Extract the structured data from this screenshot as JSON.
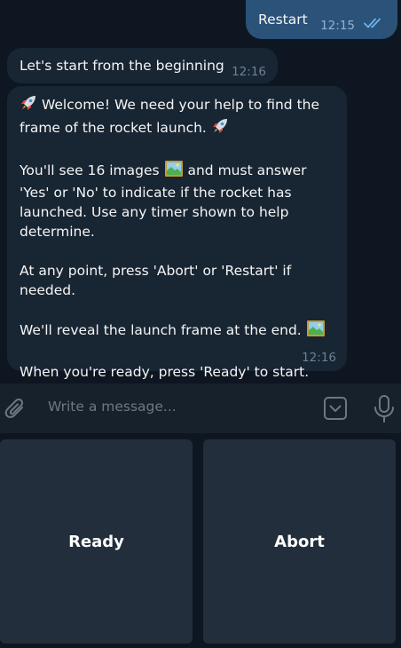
{
  "messages": {
    "outgoing": {
      "text": "Restart",
      "time": "12:15",
      "status": "read"
    },
    "incoming_1": {
      "text": "Let's start from the beginning",
      "time": "12:16"
    },
    "incoming_2": {
      "welcome_line": "Welcome! We need your help to find the frame of the rocket launch.",
      "images_before": "You'll see 16 images",
      "images_after": "and must answer 'Yes' or 'No' to indicate if the rocket has launched. Use any timer shown to help determine.",
      "abort_line": "At any point, press 'Abort' or 'Restart' if needed.",
      "reveal_line": "We'll reveal the launch frame at the end.",
      "ready_line": "When you're ready, press 'Ready' to start.",
      "time": "12:16",
      "icons": [
        "rocket-emoji",
        "picture-emoji"
      ]
    }
  },
  "composer": {
    "placeholder": "Write a message...",
    "icons": [
      "paperclip-icon",
      "keyboard-toggle-icon",
      "microphone-icon"
    ]
  },
  "keyboard": {
    "buttons": [
      {
        "label": "Ready"
      },
      {
        "label": "Abort"
      }
    ]
  },
  "colors": {
    "background": "#0e1621",
    "outgoing_bubble": "#2b5278",
    "incoming_bubble": "#182533",
    "composer": "#17212b",
    "keyboard_button": "#232e3c",
    "read_ticks": "#6ab3f3"
  }
}
